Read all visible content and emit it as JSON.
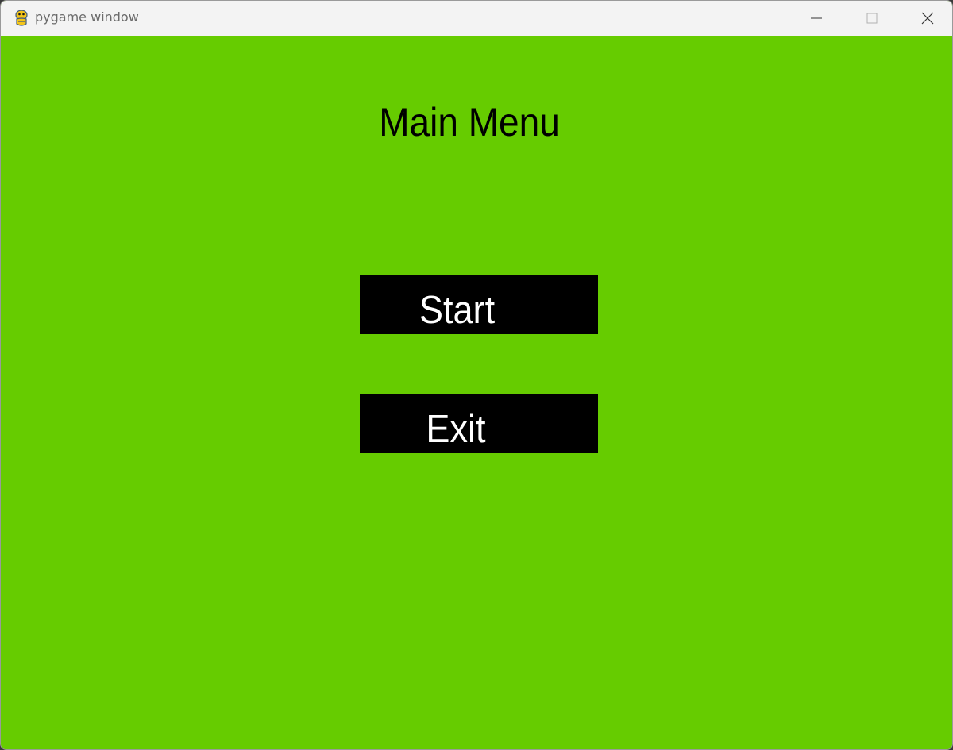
{
  "window": {
    "title": "pygame window",
    "icon": "pygame-snake-icon",
    "controls": {
      "minimize": "minimize-icon",
      "maximize": "maximize-icon",
      "close": "close-icon"
    }
  },
  "main_menu": {
    "title": "Main Menu",
    "buttons": [
      {
        "label": "Start"
      },
      {
        "label": "Exit"
      }
    ]
  },
  "colors": {
    "background": "#66cc00",
    "button_fill": "#000000",
    "button_text": "#ffffff",
    "title_text": "#000000",
    "titlebar": "#f3f3f3"
  }
}
